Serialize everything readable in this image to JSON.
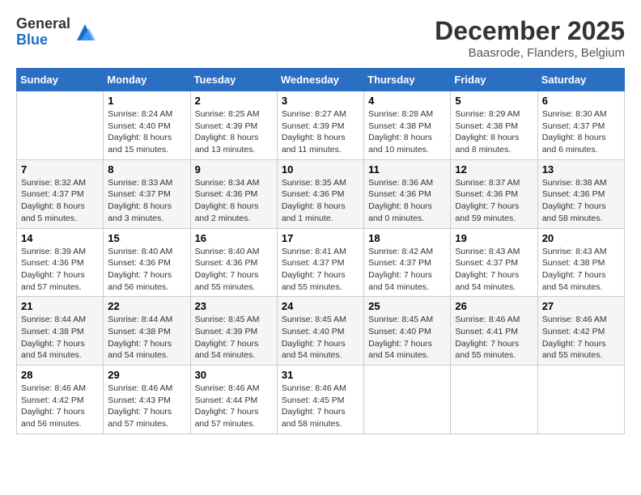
{
  "logo": {
    "general": "General",
    "blue": "Blue"
  },
  "title": {
    "month_year": "December 2025",
    "location": "Baasrode, Flanders, Belgium"
  },
  "weekdays": [
    "Sunday",
    "Monday",
    "Tuesday",
    "Wednesday",
    "Thursday",
    "Friday",
    "Saturday"
  ],
  "weeks": [
    [
      {
        "day": "",
        "sunrise": "",
        "sunset": "",
        "daylight": ""
      },
      {
        "day": "1",
        "sunrise": "Sunrise: 8:24 AM",
        "sunset": "Sunset: 4:40 PM",
        "daylight": "Daylight: 8 hours and 15 minutes."
      },
      {
        "day": "2",
        "sunrise": "Sunrise: 8:25 AM",
        "sunset": "Sunset: 4:39 PM",
        "daylight": "Daylight: 8 hours and 13 minutes."
      },
      {
        "day": "3",
        "sunrise": "Sunrise: 8:27 AM",
        "sunset": "Sunset: 4:39 PM",
        "daylight": "Daylight: 8 hours and 11 minutes."
      },
      {
        "day": "4",
        "sunrise": "Sunrise: 8:28 AM",
        "sunset": "Sunset: 4:38 PM",
        "daylight": "Daylight: 8 hours and 10 minutes."
      },
      {
        "day": "5",
        "sunrise": "Sunrise: 8:29 AM",
        "sunset": "Sunset: 4:38 PM",
        "daylight": "Daylight: 8 hours and 8 minutes."
      },
      {
        "day": "6",
        "sunrise": "Sunrise: 8:30 AM",
        "sunset": "Sunset: 4:37 PM",
        "daylight": "Daylight: 8 hours and 6 minutes."
      }
    ],
    [
      {
        "day": "7",
        "sunrise": "Sunrise: 8:32 AM",
        "sunset": "Sunset: 4:37 PM",
        "daylight": "Daylight: 8 hours and 5 minutes."
      },
      {
        "day": "8",
        "sunrise": "Sunrise: 8:33 AM",
        "sunset": "Sunset: 4:37 PM",
        "daylight": "Daylight: 8 hours and 3 minutes."
      },
      {
        "day": "9",
        "sunrise": "Sunrise: 8:34 AM",
        "sunset": "Sunset: 4:36 PM",
        "daylight": "Daylight: 8 hours and 2 minutes."
      },
      {
        "day": "10",
        "sunrise": "Sunrise: 8:35 AM",
        "sunset": "Sunset: 4:36 PM",
        "daylight": "Daylight: 8 hours and 1 minute."
      },
      {
        "day": "11",
        "sunrise": "Sunrise: 8:36 AM",
        "sunset": "Sunset: 4:36 PM",
        "daylight": "Daylight: 8 hours and 0 minutes."
      },
      {
        "day": "12",
        "sunrise": "Sunrise: 8:37 AM",
        "sunset": "Sunset: 4:36 PM",
        "daylight": "Daylight: 7 hours and 59 minutes."
      },
      {
        "day": "13",
        "sunrise": "Sunrise: 8:38 AM",
        "sunset": "Sunset: 4:36 PM",
        "daylight": "Daylight: 7 hours and 58 minutes."
      }
    ],
    [
      {
        "day": "14",
        "sunrise": "Sunrise: 8:39 AM",
        "sunset": "Sunset: 4:36 PM",
        "daylight": "Daylight: 7 hours and 57 minutes."
      },
      {
        "day": "15",
        "sunrise": "Sunrise: 8:40 AM",
        "sunset": "Sunset: 4:36 PM",
        "daylight": "Daylight: 7 hours and 56 minutes."
      },
      {
        "day": "16",
        "sunrise": "Sunrise: 8:40 AM",
        "sunset": "Sunset: 4:36 PM",
        "daylight": "Daylight: 7 hours and 55 minutes."
      },
      {
        "day": "17",
        "sunrise": "Sunrise: 8:41 AM",
        "sunset": "Sunset: 4:37 PM",
        "daylight": "Daylight: 7 hours and 55 minutes."
      },
      {
        "day": "18",
        "sunrise": "Sunrise: 8:42 AM",
        "sunset": "Sunset: 4:37 PM",
        "daylight": "Daylight: 7 hours and 54 minutes."
      },
      {
        "day": "19",
        "sunrise": "Sunrise: 8:43 AM",
        "sunset": "Sunset: 4:37 PM",
        "daylight": "Daylight: 7 hours and 54 minutes."
      },
      {
        "day": "20",
        "sunrise": "Sunrise: 8:43 AM",
        "sunset": "Sunset: 4:38 PM",
        "daylight": "Daylight: 7 hours and 54 minutes."
      }
    ],
    [
      {
        "day": "21",
        "sunrise": "Sunrise: 8:44 AM",
        "sunset": "Sunset: 4:38 PM",
        "daylight": "Daylight: 7 hours and 54 minutes."
      },
      {
        "day": "22",
        "sunrise": "Sunrise: 8:44 AM",
        "sunset": "Sunset: 4:38 PM",
        "daylight": "Daylight: 7 hours and 54 minutes."
      },
      {
        "day": "23",
        "sunrise": "Sunrise: 8:45 AM",
        "sunset": "Sunset: 4:39 PM",
        "daylight": "Daylight: 7 hours and 54 minutes."
      },
      {
        "day": "24",
        "sunrise": "Sunrise: 8:45 AM",
        "sunset": "Sunset: 4:40 PM",
        "daylight": "Daylight: 7 hours and 54 minutes."
      },
      {
        "day": "25",
        "sunrise": "Sunrise: 8:45 AM",
        "sunset": "Sunset: 4:40 PM",
        "daylight": "Daylight: 7 hours and 54 minutes."
      },
      {
        "day": "26",
        "sunrise": "Sunrise: 8:46 AM",
        "sunset": "Sunset: 4:41 PM",
        "daylight": "Daylight: 7 hours and 55 minutes."
      },
      {
        "day": "27",
        "sunrise": "Sunrise: 8:46 AM",
        "sunset": "Sunset: 4:42 PM",
        "daylight": "Daylight: 7 hours and 55 minutes."
      }
    ],
    [
      {
        "day": "28",
        "sunrise": "Sunrise: 8:46 AM",
        "sunset": "Sunset: 4:42 PM",
        "daylight": "Daylight: 7 hours and 56 minutes."
      },
      {
        "day": "29",
        "sunrise": "Sunrise: 8:46 AM",
        "sunset": "Sunset: 4:43 PM",
        "daylight": "Daylight: 7 hours and 57 minutes."
      },
      {
        "day": "30",
        "sunrise": "Sunrise: 8:46 AM",
        "sunset": "Sunset: 4:44 PM",
        "daylight": "Daylight: 7 hours and 57 minutes."
      },
      {
        "day": "31",
        "sunrise": "Sunrise: 8:46 AM",
        "sunset": "Sunset: 4:45 PM",
        "daylight": "Daylight: 7 hours and 58 minutes."
      },
      {
        "day": "",
        "sunrise": "",
        "sunset": "",
        "daylight": ""
      },
      {
        "day": "",
        "sunrise": "",
        "sunset": "",
        "daylight": ""
      },
      {
        "day": "",
        "sunrise": "",
        "sunset": "",
        "daylight": ""
      }
    ]
  ]
}
